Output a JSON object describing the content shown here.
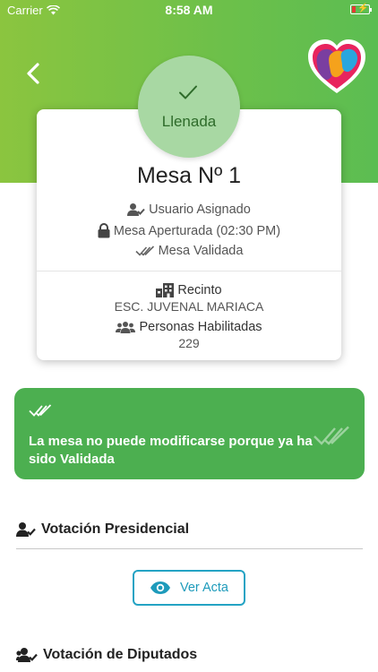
{
  "status_bar": {
    "carrier": "Carrier",
    "time": "8:58 AM"
  },
  "header": {
    "back_icon": "chevron-left-icon",
    "logo": "heart-logo"
  },
  "badge": {
    "label": "Llenada",
    "icon": "check-icon"
  },
  "card": {
    "title": "Mesa Nº 1",
    "assigned_user": "Usuario Asignado",
    "opened": "Mesa Aperturada (02:30 PM)",
    "validated": "Mesa Validada",
    "venue_label": "Recinto",
    "venue_value": "ESC. JUVENAL MARIACA",
    "voters_label": "Personas Habilitadas",
    "voters_value": "229"
  },
  "alert": {
    "message": "La mesa no puede modificarse porque ya ha sido Validada"
  },
  "sections": {
    "presidential": {
      "title": "Votación Presidencial",
      "button_label": "Ver Acta"
    },
    "deputies": {
      "title": "Votación de Diputados"
    }
  },
  "colors": {
    "header_green": "#6cc04a",
    "alert_green": "#4caf50",
    "badge_green": "#a8d8a3",
    "accent_blue": "#24a3c4"
  }
}
